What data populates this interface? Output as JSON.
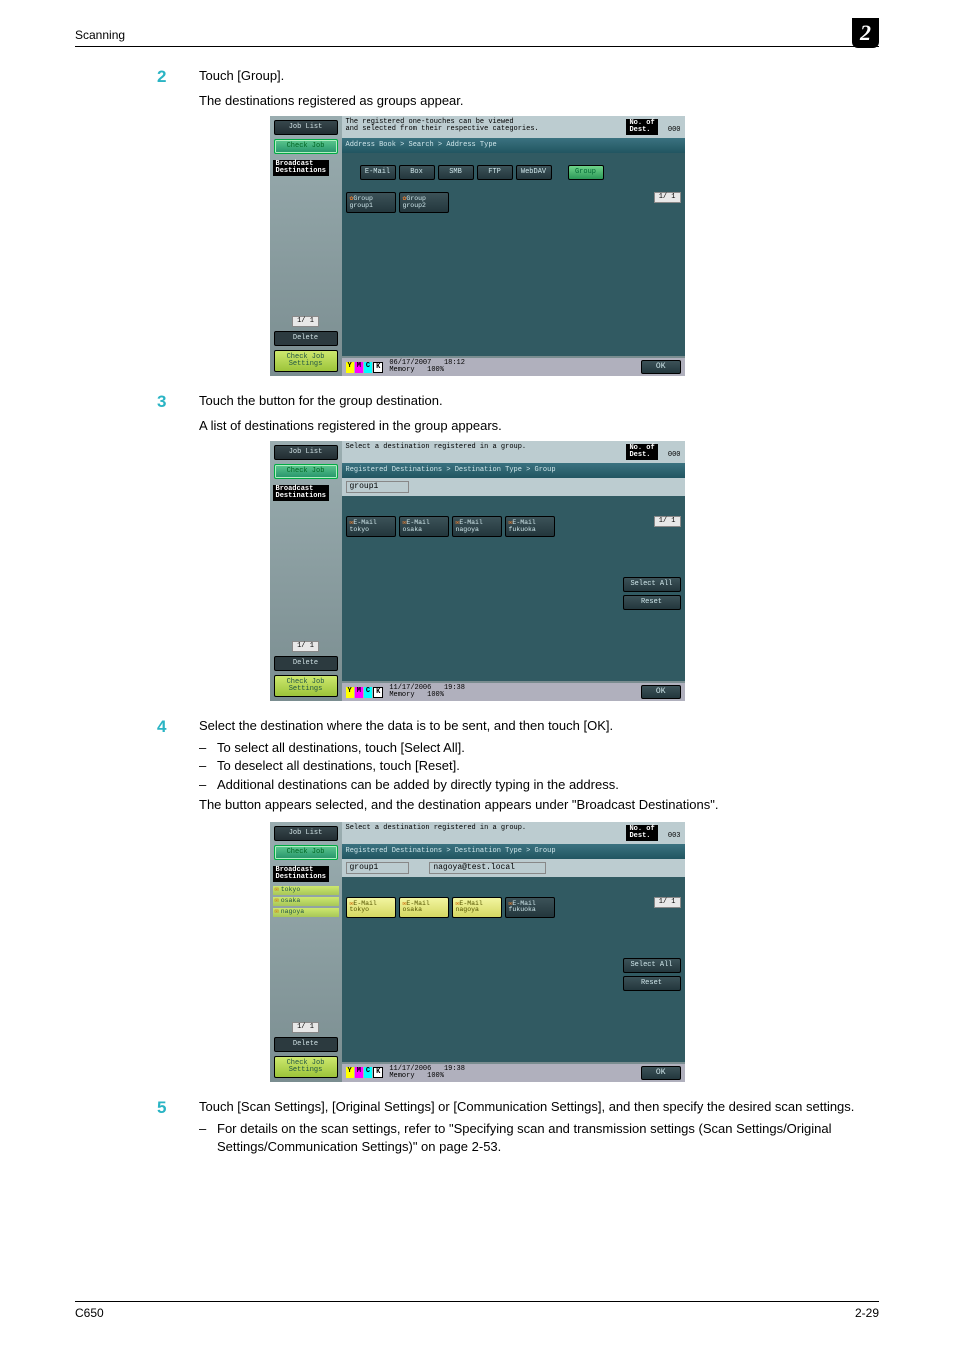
{
  "header": {
    "section": "Scanning",
    "chapter": "2"
  },
  "steps": {
    "s2": {
      "num": "2",
      "text": "Touch [Group].",
      "caption": "The destinations registered as groups appear."
    },
    "s3": {
      "num": "3",
      "text": "Touch the button for the group destination.",
      "caption": "A list of destinations registered in the group appears."
    },
    "s4": {
      "num": "4",
      "text": "Select the destination where the data is to be sent, and then touch [OK].",
      "b1": "To select all destinations, touch [Select All].",
      "b2": "To deselect all destinations, touch [Reset].",
      "b3": "Additional destinations can be added by directly typing in the address.",
      "after": "The button appears selected, and the destination appears under \"Broadcast Destinations\"."
    },
    "s5": {
      "num": "5",
      "text": "Touch [Scan Settings], [Original Settings] or [Communication Settings], and then specify the desired scan settings.",
      "b1": "For details on the scan settings, refer to \"Specifying scan and transmission settings (Scan Settings/Original Settings/Communication Settings)\" on page 2-53."
    }
  },
  "panel1": {
    "title": "The registered one-touches can be viewed\nand selected from their respective categories.",
    "destLabel": "No. of\nDest.",
    "destCount": "000",
    "jobList": "Job List",
    "checkJob": "Check Job",
    "broadcast": "Broadcast\nDestinations",
    "page": "1/  1",
    "delete": "Delete",
    "checkSettings": "Check Job\nSettings",
    "bread": "Address Book > Search > Address Type",
    "tabs": {
      "email": "E-Mail",
      "box": "Box",
      "smb": "SMB",
      "ftp": "FTP",
      "webdav": "WebDAV",
      "group": "Group"
    },
    "g1": "Group\ngroup1",
    "g2": "Group\ngroup2",
    "rpage": "1/  1",
    "date": "06/17/2007",
    "time": "18:12",
    "mem": "Memory",
    "memv": "100%",
    "ok": "OK"
  },
  "panel2": {
    "title": "Select a destination registered in a group.",
    "destLabel": "No. of\nDest.",
    "destCount": "000",
    "jobList": "Job List",
    "checkJob": "Check Job",
    "broadcast": "Broadcast\nDestinations",
    "page": "1/  1",
    "delete": "Delete",
    "checkSettings": "Check Job\nSettings",
    "bread": "Registered Destinations > Destination Type > Group",
    "groupname": "group1",
    "d1": "E-Mail\ntokyo",
    "d2": "E-Mail\nosaka",
    "d3": "E-Mail\nnagoya",
    "d4": "E-Mail\nfukuoka",
    "rpage": "1/  1",
    "selAll": "Select All",
    "reset": "Reset",
    "date": "11/17/2006",
    "time": "19:38",
    "mem": "Memory",
    "memv": "100%",
    "ok": "OK"
  },
  "panel3": {
    "title": "Select a destination registered in a group.",
    "destLabel": "No. of\nDest.",
    "destCount": "003",
    "jobList": "Job List",
    "checkJob": "Check Job",
    "broadcast": "Broadcast\nDestinations",
    "bd1": "tokyo",
    "bd2": "osaka",
    "bd3": "nagoya",
    "page": "1/  1",
    "delete": "Delete",
    "checkSettings": "Check Job\nSettings",
    "bread": "Registered Destinations > Destination Type > Group",
    "groupname": "group1",
    "addr": "nagoya@test.local",
    "d1": "E-Mail\ntokyo",
    "d2": "E-Mail\nosaka",
    "d3": "E-Mail\nnagoya",
    "d4": "E-Mail\nfukuoka",
    "rpage": "1/  1",
    "selAll": "Select All",
    "reset": "Reset",
    "date": "11/17/2006",
    "time": "19:38",
    "mem": "Memory",
    "memv": "100%",
    "ok": "OK"
  },
  "footer": {
    "left": "C650",
    "right": "2-29"
  }
}
